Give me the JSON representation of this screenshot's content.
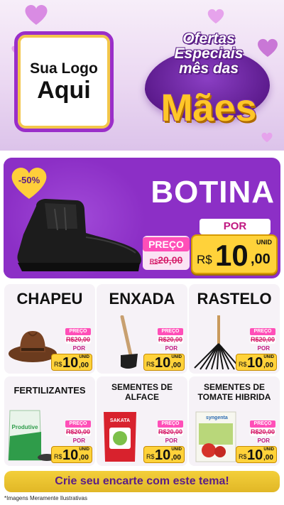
{
  "header": {
    "logo_line1": "Sua Logo",
    "logo_line2": "Aqui",
    "title_line1": "Ofertas",
    "title_line2": "Especiais",
    "title_line3": "mês das",
    "title_main": "Mães"
  },
  "featured": {
    "discount": "-50%",
    "name": "BOTINA",
    "preco_label": "PREÇO",
    "old_currency": "R$",
    "old_price": "20,00",
    "por_label": "POR",
    "unid_label": "UNID",
    "currency": "R$",
    "price_int": "10",
    "price_dec": ",00"
  },
  "products": [
    {
      "name": "CHAPEU",
      "icon": "hat-icon",
      "preco_label": "PREÇO",
      "old_currency": "R$",
      "old_price": "20,00",
      "por_label": "POR",
      "unid_label": "UNID",
      "currency": "R$",
      "price_int": "10",
      "price_dec": ",00"
    },
    {
      "name": "ENXADA",
      "icon": "hoe-icon",
      "preco_label": "PREÇO",
      "old_currency": "R$",
      "old_price": "20,00",
      "por_label": "POR",
      "unid_label": "UNID",
      "currency": "R$",
      "price_int": "10",
      "price_dec": ",00"
    },
    {
      "name": "RASTELO",
      "icon": "rake-icon",
      "preco_label": "PREÇO",
      "old_currency": "R$",
      "old_price": "20,00",
      "por_label": "POR",
      "unid_label": "UNID",
      "currency": "R$",
      "price_int": "10",
      "price_dec": ",00"
    },
    {
      "name": "FERTILIZANTES",
      "icon": "fertilizer-bag-icon",
      "bag_label": "Produtive",
      "preco_label": "PREÇO",
      "old_currency": "R$",
      "old_price": "20,00",
      "por_label": "POR",
      "unid_label": "UNID",
      "currency": "R$",
      "price_int": "10",
      "price_dec": ",00"
    },
    {
      "name_line1": "SEMENTES DE",
      "name_line2": "ALFACE",
      "icon": "lettuce-seeds-icon",
      "pack_label": "SAKATA",
      "preco_label": "PREÇO",
      "old_currency": "R$",
      "old_price": "20,00",
      "por_label": "POR",
      "unid_label": "UNID",
      "currency": "R$",
      "price_int": "10",
      "price_dec": ",00"
    },
    {
      "name_line1": "SEMENTES DE",
      "name_line2": "TOMATE HIBRIDA",
      "icon": "tomato-seeds-icon",
      "pack_label": "syngenta",
      "preco_label": "PREÇO",
      "old_currency": "R$",
      "old_price": "20,00",
      "por_label": "POR",
      "unid_label": "UNID",
      "currency": "R$",
      "price_int": "10",
      "price_dec": ",00"
    }
  ],
  "cta_label": "Crie seu encarte com este tema!",
  "footer_note": "*Imagens Meramente Ilustrativas",
  "colors": {
    "purple": "#8c2fc6",
    "yellow": "#ffd23a",
    "pink": "#ff4fb8",
    "header_bg": "#ebd8f2"
  }
}
